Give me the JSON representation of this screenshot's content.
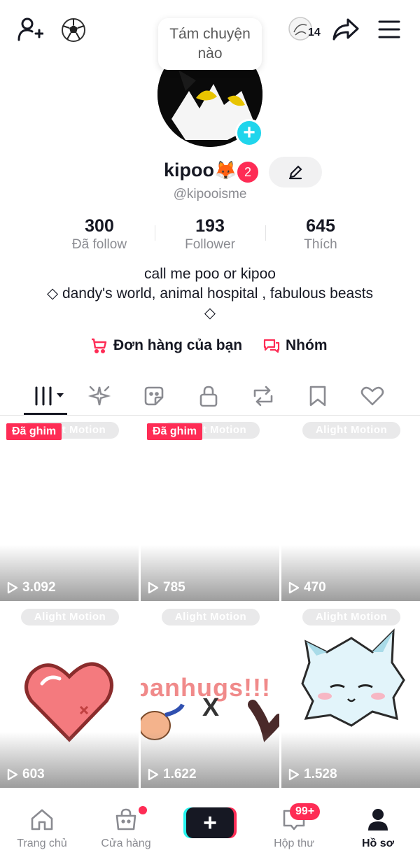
{
  "top_bar": {
    "story_count": "14",
    "tooltip_text": "Tám chuyện nào"
  },
  "profile": {
    "username": "kipoo",
    "fox_emoji": "🦊",
    "notification_count": "2",
    "handle": "@kipooisme"
  },
  "stats": [
    {
      "value": "300",
      "label": "Đã follow"
    },
    {
      "value": "193",
      "label": "Follower"
    },
    {
      "value": "645",
      "label": "Thích"
    }
  ],
  "bio": {
    "line1": "call me poo or kipoo",
    "line2": "◇ dandy's world, animal hospital , fabulous beasts ◇"
  },
  "links": {
    "orders": "Đơn hàng của bạn",
    "groups": "Nhóm"
  },
  "tabs": [
    {
      "icon": "videos-grid-icon",
      "active": true
    },
    {
      "icon": "sparkle-icon"
    },
    {
      "icon": "sticker-icon"
    },
    {
      "icon": "lock-icon"
    },
    {
      "icon": "repost-icon"
    },
    {
      "icon": "bookmark-icon"
    },
    {
      "icon": "heart-icon"
    }
  ],
  "videos": [
    {
      "views": "3.092",
      "pinned": "Đã ghim",
      "watermark": "Alight Motion"
    },
    {
      "views": "785",
      "pinned": "Đã ghim",
      "watermark": "Alight Motion"
    },
    {
      "views": "470",
      "watermark": "Alight Motion"
    },
    {
      "views": "603",
      "watermark": "Alight Motion"
    },
    {
      "views": "1.622",
      "watermark": "Alight Motion",
      "overlay_text": "panhugs!!!",
      "x_mark": "X"
    },
    {
      "views": "1.528",
      "watermark": "Alight Motion"
    }
  ],
  "bottom_nav": {
    "home": "Trang chủ",
    "shop": "Cửa hàng",
    "inbox": "Hộp thư",
    "inbox_badge": "99+",
    "profile": "Hồ sơ"
  },
  "colors": {
    "accent_red": "#fe2c55",
    "accent_cyan": "#20d5ec",
    "text_dark": "#161823",
    "text_gray": "#8a8b91"
  }
}
